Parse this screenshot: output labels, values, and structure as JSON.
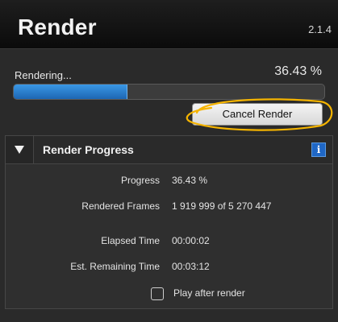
{
  "window": {
    "title": "Render",
    "version": "2.1.4"
  },
  "progress_area": {
    "status": "Rendering...",
    "percent_text": "36.43 %",
    "progress_fraction": 0.3643,
    "cancel_label": "Cancel Render",
    "annotation_color": "#f5b400"
  },
  "render_progress": {
    "title": "Render Progress",
    "info_icon_text": "i",
    "rows": [
      {
        "label": "Progress",
        "value": "36.43 %"
      },
      {
        "label": "Rendered Frames",
        "value": "1 919 999 of 5 270 447"
      },
      {
        "label": "Elapsed Time",
        "value": "00:00:02"
      },
      {
        "label": "Est. Remaining Time",
        "value": "00:03:12"
      }
    ],
    "play_after_render": {
      "label": "Play after render",
      "checked": false
    }
  },
  "colors": {
    "accent_blue": "#2a7fd4",
    "info_blue": "#1f67c6"
  }
}
